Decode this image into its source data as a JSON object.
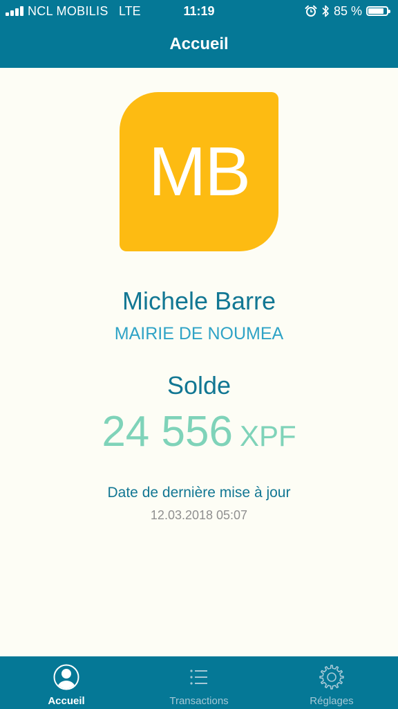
{
  "status_bar": {
    "carrier": "NCL MOBILIS",
    "network": "LTE",
    "time": "11:19",
    "battery_percent": "85 %",
    "battery_level": 0.85
  },
  "header": {
    "title": "Accueil"
  },
  "profile": {
    "initials": "MB",
    "name": "Michele Barre",
    "organisation": "MAIRIE DE NOUMEA",
    "avatar_color": "#fdbb12"
  },
  "balance": {
    "label": "Solde",
    "amount": "24 556",
    "currency": "XPF"
  },
  "last_update": {
    "label": "Date de dernière mise à jour",
    "value": "12.03.2018 05:07"
  },
  "tabs": [
    {
      "label": "Accueil",
      "icon": "user-circle-icon",
      "active": true
    },
    {
      "label": "Transactions",
      "icon": "list-icon",
      "active": false
    },
    {
      "label": "Réglages",
      "icon": "gear-icon",
      "active": false
    }
  ],
  "colors": {
    "primary": "#057896",
    "name_text": "#127793",
    "organisation_text": "#2fa3c6",
    "balance_text": "#7fd3b9",
    "background": "#fdfdf5"
  }
}
